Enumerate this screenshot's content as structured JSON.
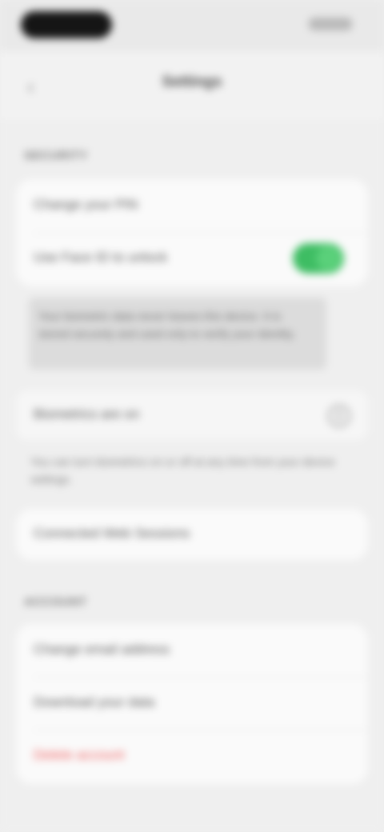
{
  "nav": {
    "back_glyph": "‹",
    "title": "Settings"
  },
  "sections": {
    "security_label": "Security",
    "account_label": "Account"
  },
  "security": {
    "change_pin_label": "Change your PIN",
    "face_id_label": "Use Face ID to unlock",
    "face_id_enabled": true,
    "info_text": "Your biometric data never leaves this device. It is stored securely and used only to verify your identity.",
    "biometric_status_label": "Biometrics are on",
    "info_icon": "i",
    "footnote": "You can turn biometrics on or off at any time from your device settings.",
    "connected_label": "Connected Web Sessions"
  },
  "account": {
    "change_email_label": "Change email address",
    "manage_data_label": "Download your data",
    "delete_label": "Delete account"
  },
  "colors": {
    "toggle_on": "#3ebd63",
    "danger": "#ef5b5b"
  }
}
